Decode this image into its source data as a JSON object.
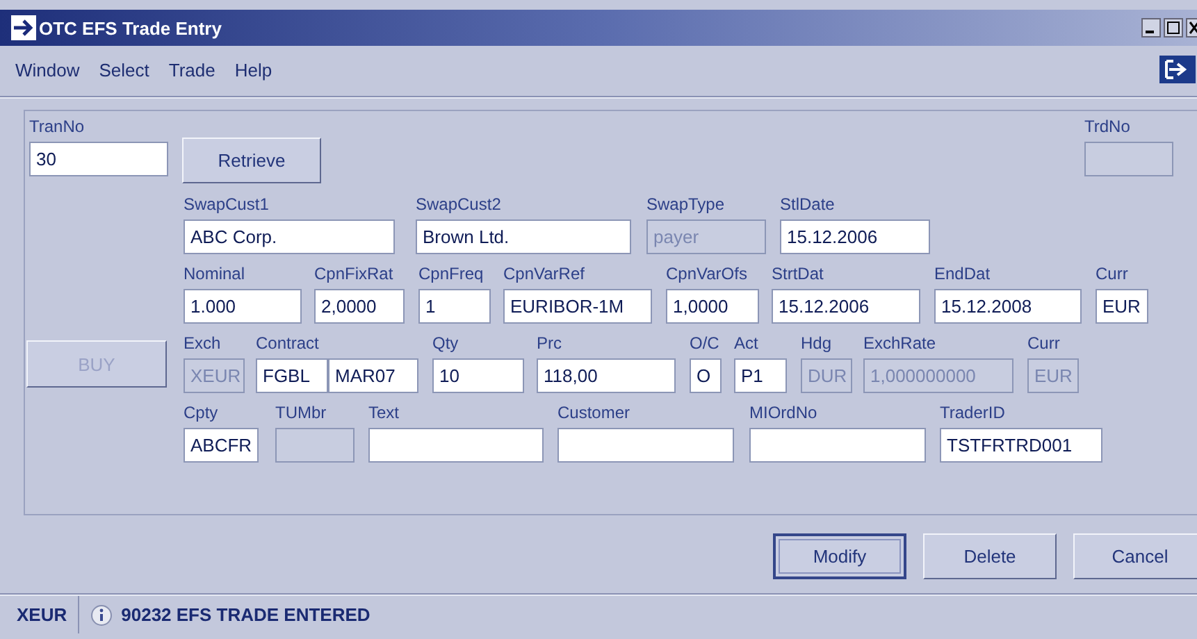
{
  "window": {
    "title": "OTC EFS Trade Entry"
  },
  "menu": [
    {
      "label": "Window"
    },
    {
      "label": "Select"
    },
    {
      "label": "Trade"
    },
    {
      "label": "Help"
    }
  ],
  "tran_no": {
    "label": "TranNo",
    "value": "30"
  },
  "retrieve_button": {
    "label": "Retrieve"
  },
  "trd_no": {
    "label": "TrdNo",
    "disabled": true
  },
  "buy_button": {
    "label": "BUY",
    "disabled": true
  },
  "rows": [
    [
      {
        "label": "SwapCust1",
        "value": "ABC Corp.",
        "disabled": false
      },
      {
        "label": "SwapCust2",
        "value": "Brown Ltd.",
        "disabled": false
      },
      {
        "label": "SwapType",
        "value": "payer",
        "disabled": true
      },
      {
        "label": "StlDate",
        "value": "15.12.2006",
        "disabled": false
      }
    ],
    [
      {
        "label": "Nominal",
        "value": "1.000",
        "disabled": false
      },
      {
        "label": "CpnFixRat",
        "value": "2,0000",
        "disabled": false
      },
      {
        "label": "CpnFreq",
        "value": "1",
        "disabled": false
      },
      {
        "label": "CpnVarRef",
        "value": "EURIBOR-1M",
        "disabled": false
      },
      {
        "label": "CpnVarOfs",
        "value": "1,0000",
        "disabled": false
      },
      {
        "label": "StrtDat",
        "value": "15.12.2006",
        "disabled": false
      },
      {
        "label": "EndDat",
        "value": "15.12.2008",
        "disabled": false
      },
      {
        "label": "Curr",
        "value": "EUR",
        "disabled": false
      }
    ],
    [
      {
        "label": "Exch",
        "value": "XEUR",
        "disabled": true
      },
      {
        "label": "Contract",
        "value": "FGBL",
        "disabled": false
      },
      {
        "value": "MAR07",
        "disabled": false
      },
      {
        "label": "Qty",
        "value": "10",
        "disabled": false
      },
      {
        "label": "Prc",
        "value": "118,00",
        "disabled": false
      },
      {
        "label": "O/C",
        "value": "O",
        "disabled": false
      },
      {
        "label": "Act",
        "value": "P1",
        "disabled": false
      },
      {
        "label": "Hdg",
        "value": "DUR",
        "disabled": true
      },
      {
        "label": "ExchRate",
        "value": "1,000000000",
        "disabled": true
      },
      {
        "label": "Curr",
        "value": "EUR",
        "disabled": true
      }
    ],
    [
      {
        "label": "Cpty",
        "value": "ABCFR",
        "disabled": false
      },
      {
        "label": "TUMbr",
        "disabled": true
      },
      {
        "label": "Text",
        "disabled": false
      },
      {
        "label": "Customer",
        "disabled": false
      },
      {
        "label": "MIOrdNo",
        "disabled": false
      },
      {
        "label": "TraderID",
        "value": "TSTFRTRD001",
        "disabled": false
      }
    ]
  ],
  "actions": [
    {
      "label": "Modify",
      "default": true
    },
    {
      "label": "Delete",
      "default": false
    },
    {
      "label": "Cancel",
      "default": false
    }
  ],
  "status_bar": {
    "exchange": "XEUR",
    "message": "90232 EFS TRADE ENTERED"
  }
}
